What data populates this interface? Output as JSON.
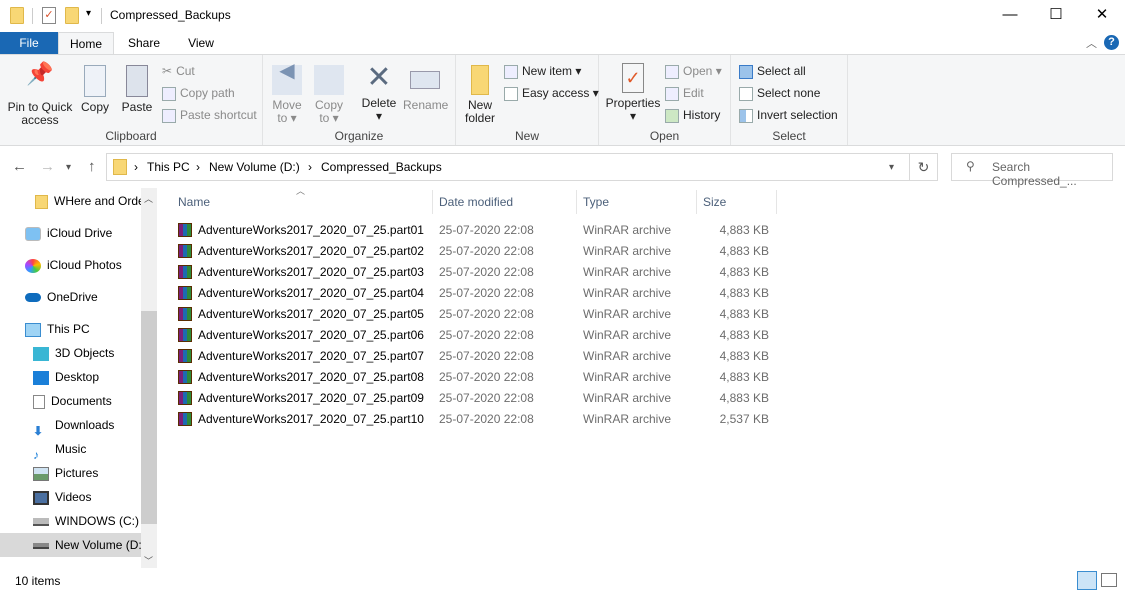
{
  "window": {
    "title": "Compressed_Backups",
    "minimize": "—",
    "maximize": "☐",
    "close": "✕"
  },
  "tabs": [
    {
      "label": "File"
    },
    {
      "label": "Home"
    },
    {
      "label": "Share"
    },
    {
      "label": "View"
    }
  ],
  "ribbon": {
    "clipboard": {
      "label": "Clipboard",
      "pin": "Pin to Quick access",
      "copy": "Copy",
      "paste": "Paste",
      "cut": "Cut",
      "copy_path": "Copy path",
      "paste_shortcut": "Paste shortcut"
    },
    "organize": {
      "label": "Organize",
      "move_to": "Move to",
      "copy_to": "Copy to",
      "delete": "Delete",
      "rename": "Rename"
    },
    "new": {
      "label": "New",
      "new_folder": "New folder",
      "new_item": "New item",
      "easy_access": "Easy access"
    },
    "open": {
      "label": "Open",
      "properties": "Properties",
      "open": "Open",
      "edit": "Edit",
      "history": "History"
    },
    "select": {
      "label": "Select",
      "select_all": "Select all",
      "select_none": "Select none",
      "invert": "Invert selection"
    }
  },
  "address": {
    "crumbs": [
      "This PC",
      "New Volume (D:)",
      "Compressed_Backups"
    ],
    "search_placeholder": "Search Compressed_..."
  },
  "nav": [
    {
      "label": "WHere and Order"
    },
    {
      "label": "iCloud Drive"
    },
    {
      "label": "iCloud Photos"
    },
    {
      "label": "OneDrive"
    },
    {
      "label": "This PC"
    },
    {
      "label": "3D Objects"
    },
    {
      "label": "Desktop"
    },
    {
      "label": "Documents"
    },
    {
      "label": "Downloads"
    },
    {
      "label": "Music"
    },
    {
      "label": "Pictures"
    },
    {
      "label": "Videos"
    },
    {
      "label": "WINDOWS (C:)"
    },
    {
      "label": "New Volume (D:)"
    }
  ],
  "columns": {
    "name": "Name",
    "date": "Date modified",
    "type": "Type",
    "size": "Size"
  },
  "files": [
    {
      "name": "AdventureWorks2017_2020_07_25.part01",
      "date": "25-07-2020 22:08",
      "type": "WinRAR archive",
      "size": "4,883 KB"
    },
    {
      "name": "AdventureWorks2017_2020_07_25.part02",
      "date": "25-07-2020 22:08",
      "type": "WinRAR archive",
      "size": "4,883 KB"
    },
    {
      "name": "AdventureWorks2017_2020_07_25.part03",
      "date": "25-07-2020 22:08",
      "type": "WinRAR archive",
      "size": "4,883 KB"
    },
    {
      "name": "AdventureWorks2017_2020_07_25.part04",
      "date": "25-07-2020 22:08",
      "type": "WinRAR archive",
      "size": "4,883 KB"
    },
    {
      "name": "AdventureWorks2017_2020_07_25.part05",
      "date": "25-07-2020 22:08",
      "type": "WinRAR archive",
      "size": "4,883 KB"
    },
    {
      "name": "AdventureWorks2017_2020_07_25.part06",
      "date": "25-07-2020 22:08",
      "type": "WinRAR archive",
      "size": "4,883 KB"
    },
    {
      "name": "AdventureWorks2017_2020_07_25.part07",
      "date": "25-07-2020 22:08",
      "type": "WinRAR archive",
      "size": "4,883 KB"
    },
    {
      "name": "AdventureWorks2017_2020_07_25.part08",
      "date": "25-07-2020 22:08",
      "type": "WinRAR archive",
      "size": "4,883 KB"
    },
    {
      "name": "AdventureWorks2017_2020_07_25.part09",
      "date": "25-07-2020 22:08",
      "type": "WinRAR archive",
      "size": "4,883 KB"
    },
    {
      "name": "AdventureWorks2017_2020_07_25.part10",
      "date": "25-07-2020 22:08",
      "type": "WinRAR archive",
      "size": "2,537 KB"
    }
  ],
  "status": {
    "count": "10 items"
  }
}
